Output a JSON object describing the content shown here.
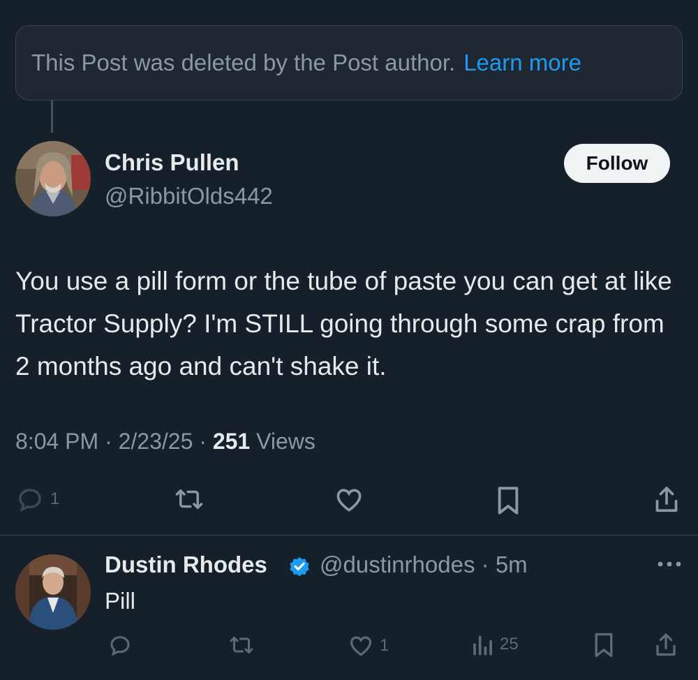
{
  "deleted_notice": {
    "text": "This Post was deleted by the Post author.",
    "link": "Learn more"
  },
  "post": {
    "author_name": "Chris Pullen",
    "author_handle": "@RibbitOlds442",
    "follow_label": "Follow",
    "text": "You use a pill form or the tube of paste you can get at like Tractor Supply? I'm STILL going through some crap from 2 months ago and can't shake it.",
    "time": "8:04 PM",
    "date": "2/23/25",
    "separator": "·",
    "views_count": "251",
    "views_label": "Views",
    "actions": {
      "reply_count": "1",
      "reply_icon": "comment-icon",
      "retweet_icon": "retweet-icon",
      "like_icon": "heart-icon",
      "bookmark_icon": "bookmark-icon",
      "share_icon": "share-icon"
    }
  },
  "reply": {
    "author_name": "Dustin Rhodes",
    "verified": true,
    "author_handle": "@dustinrhodes",
    "time_ago": "5m",
    "separator": "·",
    "text": "Pill",
    "like_count": "1",
    "views_count": "25",
    "more_icon": "more-icon"
  },
  "colors": {
    "background": "#15202b",
    "text_primary": "#e7e9ea",
    "text_secondary": "#8b98a5",
    "accent": "#1d9bf0",
    "divider": "#38444d"
  }
}
